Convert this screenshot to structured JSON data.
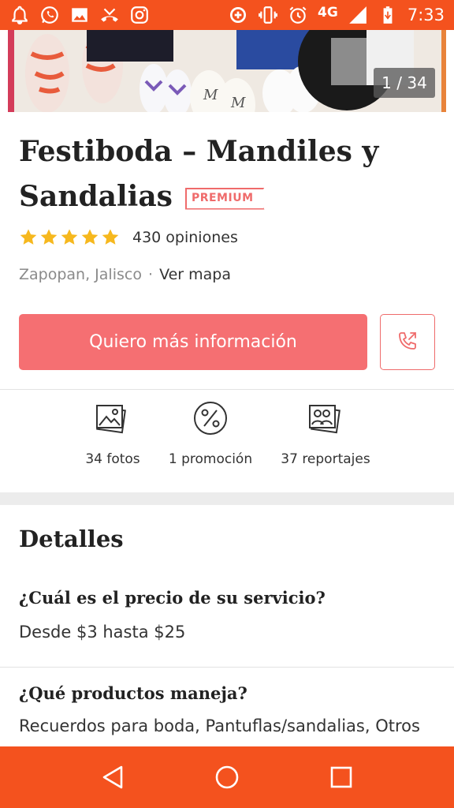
{
  "status_bar": {
    "network": "4G",
    "time": "7:33",
    "icons_left": [
      "notification-bell-icon",
      "whatsapp-icon",
      "image-icon",
      "missed-call-icon",
      "instagram-icon"
    ],
    "icons_right": [
      "data-saver-icon",
      "vibrate-icon",
      "alarm-icon",
      "signal-icon",
      "battery-icon"
    ]
  },
  "gallery": {
    "counter": "1 / 34"
  },
  "vendor": {
    "title_line1": "Festiboda – Mandiles y",
    "title_line2": "Sandalias",
    "badge": "PREMIUM",
    "rating_stars": 5,
    "reviews": "430 opiniones",
    "location": "Zapopan, Jalisco",
    "separator": "·",
    "map_link": "Ver mapa"
  },
  "actions": {
    "cta": "Quiero más información"
  },
  "stats": [
    {
      "label": "34 fotos",
      "icon": "photos-icon"
    },
    {
      "label": "1 promoción",
      "icon": "percent-icon"
    },
    {
      "label": "37 reportajes",
      "icon": "albums-icon"
    }
  ],
  "details": {
    "title": "Detalles",
    "items": [
      {
        "question": "¿Cuál es el precio de su servicio?",
        "answer": "Desde $3 hasta $25"
      },
      {
        "question": "¿Qué productos maneja?",
        "answer": "Recuerdos para boda, Pantuflas/sandalias, Otros"
      }
    ]
  },
  "colors": {
    "brand": "#f4521e",
    "cta": "#f56f72",
    "star": "#f6b81e"
  }
}
